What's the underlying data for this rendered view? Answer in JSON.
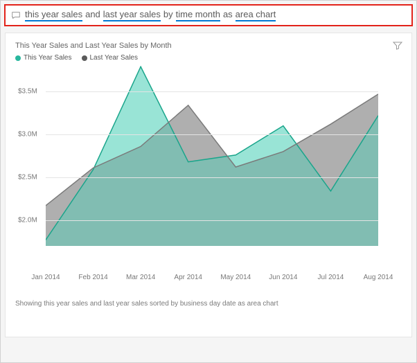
{
  "qna": {
    "tokens": [
      {
        "text": "this year sales",
        "underlined": true
      },
      {
        "text": "and",
        "underlined": false
      },
      {
        "text": "last year sales",
        "underlined": true
      },
      {
        "text": "by",
        "underlined": false
      },
      {
        "text": "time month",
        "underlined": true
      },
      {
        "text": "as",
        "underlined": false
      },
      {
        "text": "area chart",
        "underlined": true
      }
    ]
  },
  "chart": {
    "title": "This Year Sales and Last Year Sales by Month",
    "legend": [
      {
        "label": "This Year Sales",
        "color": "#29b79e"
      },
      {
        "label": "Last Year Sales",
        "color": "#5b5b5b"
      }
    ],
    "footer": "Showing this year sales and last year sales sorted by business day date as area chart"
  },
  "colors": {
    "thisYear": "#29b79e",
    "thisYearFill": "rgba(98,214,192,0.65)",
    "lastYear": "#7a7a7a",
    "lastYearFill": "rgba(130,130,130,0.55)",
    "thisYearMarker": "#1aa58b",
    "lastYearMarker": "#3a3a3a"
  },
  "chart_data": {
    "type": "area",
    "title": "This Year Sales and Last Year Sales by Month",
    "xlabel": "",
    "ylabel": "",
    "ylim": [
      1700000,
      3800000
    ],
    "y_ticks": [
      2000000,
      2500000,
      3000000,
      3500000
    ],
    "y_tick_labels": [
      "$2.0M",
      "$2.5M",
      "$3.0M",
      "$3.5M"
    ],
    "categories": [
      "Jan 2014",
      "Feb 2014",
      "Mar 2014",
      "Apr 2014",
      "May 2014",
      "Jun 2014",
      "Jul 2014",
      "Aug 2014"
    ],
    "series": [
      {
        "name": "This Year Sales",
        "values": [
          1770000,
          2590000,
          3790000,
          2680000,
          2760000,
          3100000,
          2340000,
          3220000
        ]
      },
      {
        "name": "Last Year Sales",
        "values": [
          2170000,
          2610000,
          2860000,
          3340000,
          2620000,
          2800000,
          3120000,
          3470000
        ]
      }
    ]
  }
}
